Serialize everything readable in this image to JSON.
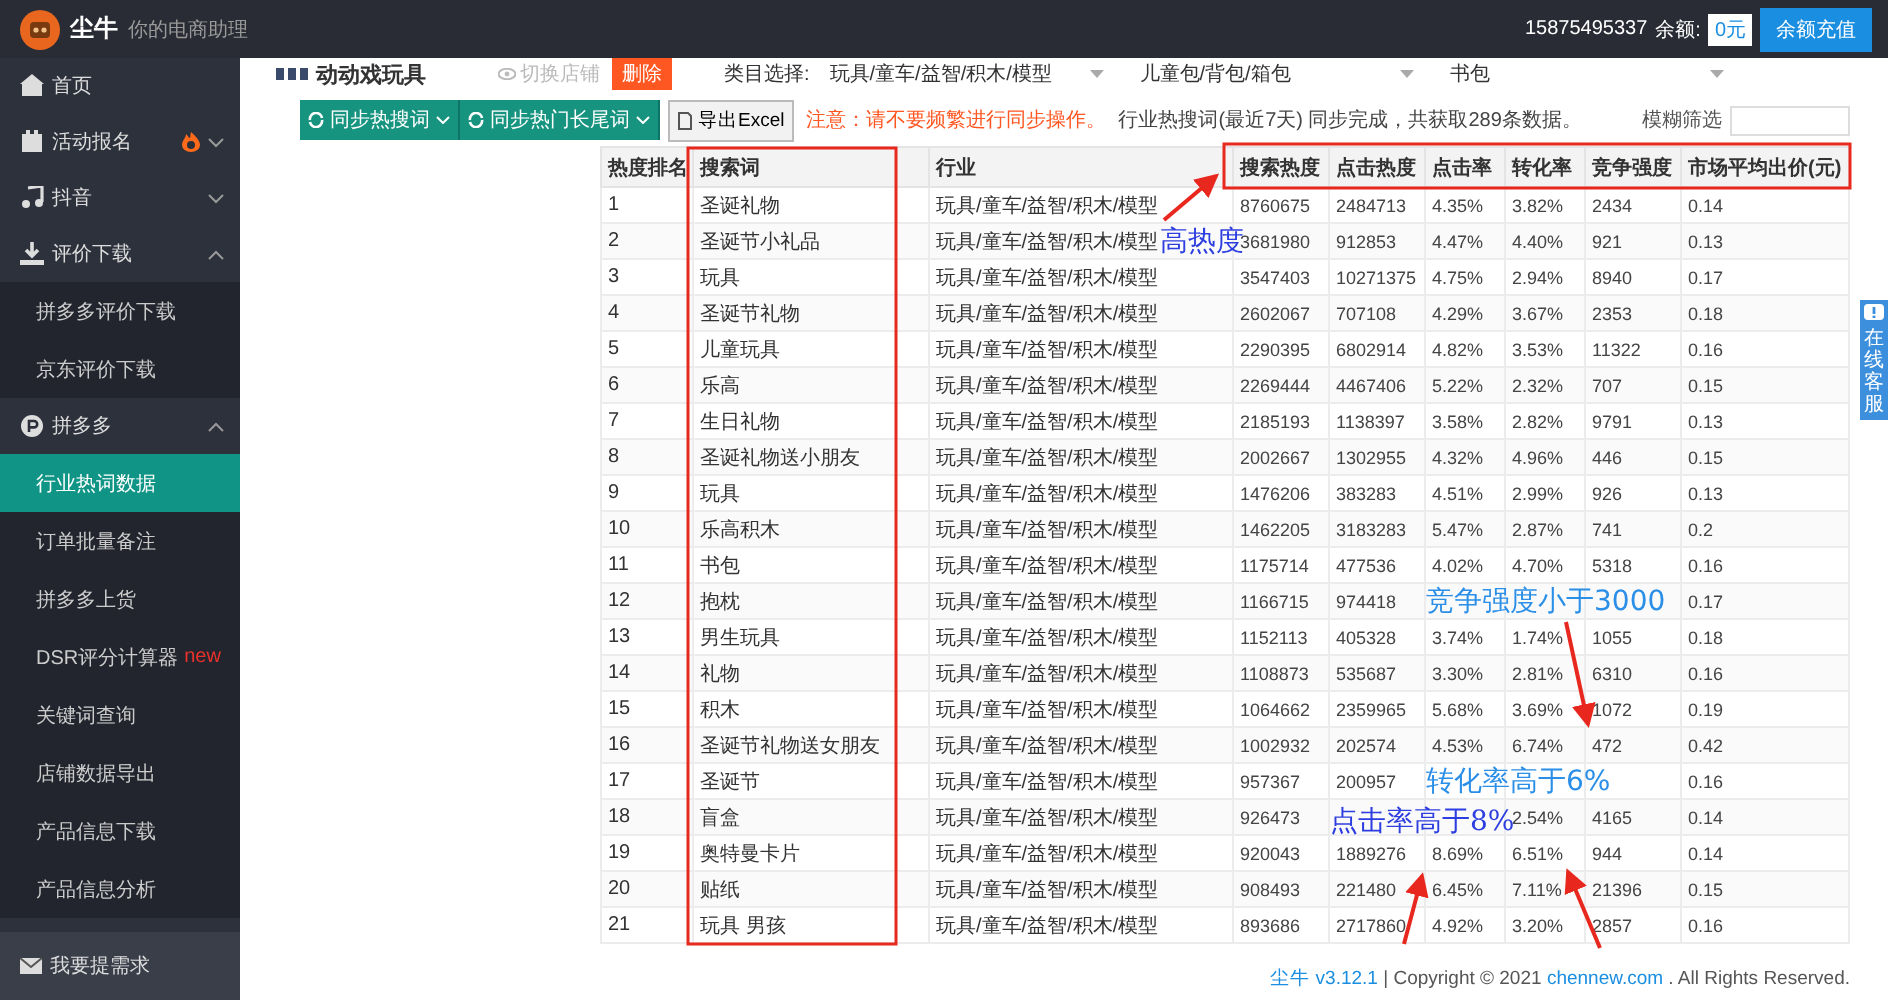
{
  "header": {
    "brand": "尘牛",
    "tagline": "你的电商助理",
    "phone": "15875495337",
    "balance_label": "余额:",
    "balance": "0元",
    "recharge": "余额充值"
  },
  "sidebar": {
    "items": [
      {
        "label": "首页"
      },
      {
        "label": "活动报名",
        "expanded": false
      },
      {
        "label": "抖音",
        "expanded": false
      },
      {
        "label": "评价下载",
        "expanded": true,
        "children": [
          {
            "label": "拼多多评价下载",
            "selected": false
          },
          {
            "label": "京东评价下载",
            "selected": false
          }
        ]
      },
      {
        "label": "拼多多",
        "expanded": true,
        "children": [
          {
            "label": "行业热词数据",
            "selected": true
          },
          {
            "label": "订单批量备注",
            "selected": false
          },
          {
            "label": "拼多多上货",
            "selected": false
          },
          {
            "label": "DSR评分计算器",
            "selected": false,
            "badge": "new"
          },
          {
            "label": "关键词查询",
            "selected": false
          },
          {
            "label": "店铺数据导出",
            "selected": false
          },
          {
            "label": "产品信息下载",
            "selected": false
          },
          {
            "label": "产品信息分析",
            "selected": false
          }
        ]
      }
    ],
    "footer": "我要提需求"
  },
  "shop": {
    "name": "动动戏玩具",
    "switch": "切换店铺",
    "delete": "删除"
  },
  "category": {
    "label": "类目选择:",
    "selects": [
      "玩具/童车/益智/积木/模型",
      "儿童包/背包/箱包",
      "书包"
    ]
  },
  "toolbar": {
    "buttons": [
      "同步热搜词",
      "同步热门长尾词"
    ],
    "export": "导出Excel",
    "warning": "注意：请不要频繁进行同步操作。",
    "status": "行业热搜词(最近7天) 同步完成，共获取289条数据。",
    "filter_label": "模糊筛选"
  },
  "table": {
    "columns": [
      "热度排名",
      "搜索词",
      "行业",
      "搜索热度",
      "点击热度",
      "点击率",
      "转化率",
      "竞争强度",
      "市场平均出价(元)"
    ],
    "rows": [
      [
        "1",
        "圣诞礼物",
        "玩具/童车/益智/积木/模型",
        "8760675",
        "2484713",
        "4.35%",
        "3.82%",
        "2434",
        "0.14"
      ],
      [
        "2",
        "圣诞节小礼品",
        "玩具/童车/益智/积木/模型",
        "3681980",
        "912853",
        "4.47%",
        "4.40%",
        "921",
        "0.13"
      ],
      [
        "3",
        "玩具",
        "玩具/童车/益智/积木/模型",
        "3547403",
        "10271375",
        "4.75%",
        "2.94%",
        "8940",
        "0.17"
      ],
      [
        "4",
        "圣诞节礼物",
        "玩具/童车/益智/积木/模型",
        "2602067",
        "707108",
        "4.29%",
        "3.67%",
        "2353",
        "0.18"
      ],
      [
        "5",
        "儿童玩具",
        "玩具/童车/益智/积木/模型",
        "2290395",
        "6802914",
        "4.82%",
        "3.53%",
        "11322",
        "0.16"
      ],
      [
        "6",
        "乐高",
        "玩具/童车/益智/积木/模型",
        "2269444",
        "4467406",
        "5.22%",
        "2.32%",
        "707",
        "0.15"
      ],
      [
        "7",
        "生日礼物",
        "玩具/童车/益智/积木/模型",
        "2185193",
        "1138397",
        "3.58%",
        "2.82%",
        "9791",
        "0.13"
      ],
      [
        "8",
        "圣诞礼物送小朋友",
        "玩具/童车/益智/积木/模型",
        "2002667",
        "1302955",
        "4.32%",
        "4.96%",
        "446",
        "0.15"
      ],
      [
        "9",
        "玩具",
        "玩具/童车/益智/积木/模型",
        "1476206",
        "383283",
        "4.51%",
        "2.99%",
        "926",
        "0.13"
      ],
      [
        "10",
        "乐高积木",
        "玩具/童车/益智/积木/模型",
        "1462205",
        "3183283",
        "5.47%",
        "2.87%",
        "741",
        "0.2"
      ],
      [
        "11",
        "书包",
        "玩具/童车/益智/积木/模型",
        "1175714",
        "477536",
        "4.02%",
        "4.70%",
        "5318",
        "0.16"
      ],
      [
        "12",
        "抱枕",
        "玩具/童车/益智/积木/模型",
        "1166715",
        "974418",
        null,
        null,
        null,
        "0.17"
      ],
      [
        "13",
        "男生玩具",
        "玩具/童车/益智/积木/模型",
        "1152113",
        "405328",
        "3.74%",
        "1.74%",
        "1055",
        "0.18"
      ],
      [
        "14",
        "礼物",
        "玩具/童车/益智/积木/模型",
        "1108873",
        "535687",
        "3.30%",
        "2.81%",
        "6310",
        "0.16"
      ],
      [
        "15",
        "积木",
        "玩具/童车/益智/积木/模型",
        "1064662",
        "2359965",
        "5.68%",
        "3.69%",
        "1072",
        "0.19"
      ],
      [
        "16",
        "圣诞节礼物送女朋友",
        "玩具/童车/益智/积木/模型",
        "1002932",
        "202574",
        "4.53%",
        "6.74%",
        "472",
        "0.42"
      ],
      [
        "17",
        "圣诞节",
        "玩具/童车/益智/积木/模型",
        "957367",
        "200957",
        null,
        null,
        null,
        "0.16"
      ],
      [
        "18",
        "盲盒",
        "玩具/童车/益智/积木/模型",
        "926473",
        null,
        null,
        "2.54%",
        "4165",
        "0.14"
      ],
      [
        "19",
        "奥特曼卡片",
        "玩具/童车/益智/积木/模型",
        "920043",
        "1889276",
        "8.69%",
        "6.51%",
        "944",
        "0.14"
      ],
      [
        "20",
        "贴纸",
        "玩具/童车/益智/积木/模型",
        "908493",
        "221480",
        "6.45%",
        "7.11%",
        "21396",
        "0.15"
      ],
      [
        "21",
        "玩具 男孩",
        "玩具/童车/益智/积木/模型",
        "893686",
        "2717860",
        "4.92%",
        "3.20%",
        "2857",
        "0.16"
      ]
    ]
  },
  "annotations": [
    "高热度",
    "竞争强度小于3000",
    "转化率高于6%",
    "点击率高于8%"
  ],
  "support_tab": "在线客服",
  "footer": {
    "brand": "尘牛 v3.12.1",
    "copyright": "| Copyright © 2021",
    "link": "chennew.com",
    "rights": ". All Rights Reserved."
  }
}
